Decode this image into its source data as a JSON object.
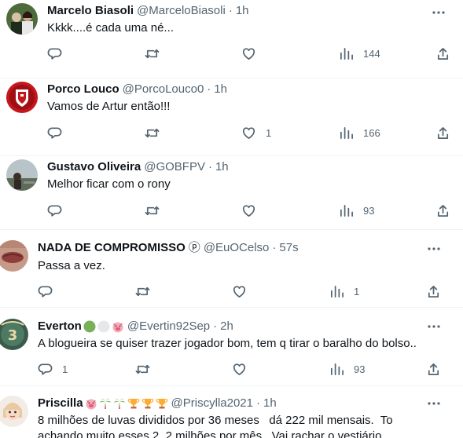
{
  "tweets": [
    {
      "name": "Marcelo Biasoli",
      "handle": "@MarceloBiasoli",
      "time": "1h",
      "text": "Kkkk....é cada uma né...",
      "replies": "",
      "retweets": "",
      "likes": "",
      "views": "144"
    },
    {
      "name": "Porco Louco",
      "handle": "@PorcoLouco0",
      "time": "1h",
      "text": "Vamos de Artur então!!!",
      "replies": "",
      "retweets": "",
      "likes": "1",
      "views": "166"
    },
    {
      "name": "Gustavo Oliveira",
      "handle": "@GOBFPV",
      "time": "1h",
      "text": "Melhor ficar com o rony",
      "replies": "",
      "retweets": "",
      "likes": "",
      "views": "93"
    },
    {
      "name": "NADA DE COMPROMISSO",
      "badge": "ⓟ",
      "handle": "@EuOCelso",
      "time": "57s",
      "text": "Passa a vez.",
      "replies": "",
      "retweets": "",
      "likes": "",
      "views": "1"
    },
    {
      "name": "Everton",
      "handle": "@Evertin92Sep",
      "time": "2h",
      "text": "A blogueira se quiser trazer jogador bom, tem q tirar o baralho do bolso..",
      "replies": "1",
      "retweets": "",
      "likes": "",
      "views": "93"
    },
    {
      "name": "Priscilla",
      "handle": "@Priscylla2021",
      "time": "1h",
      "text_line1": "8 milhões de luvas divididos por 36 meses   dá 222 mil mensais.  To",
      "text_line2": "achando muito esses 2, 2 milhões por mês . Vai rachar o vestiário"
    }
  ],
  "colors": {
    "text": "#0f1419",
    "secondary": "#536471",
    "divider": "#eff3f4",
    "green": "#78b159",
    "white_circle": "#e6e7e8",
    "pig": "#f4abba",
    "trophy": "#ffac33",
    "palm": "#77b255"
  }
}
